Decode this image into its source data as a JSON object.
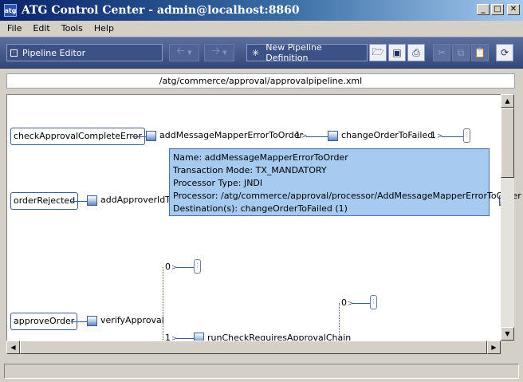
{
  "window": {
    "icon_label": "atg",
    "title": "ATG Control Center - admin@localhost:8860",
    "minimize": "_",
    "maximize": "□",
    "close": "✕"
  },
  "menu": [
    "File",
    "Edit",
    "Tools",
    "Help"
  ],
  "toolbar": {
    "editor_select": "Pipeline Editor",
    "new_definition": "New Pipeline Definition",
    "icons": [
      "back-icon",
      "forward-icon",
      "open-folder-icon",
      "save-icon",
      "print-icon",
      "cut-icon",
      "copy-icon",
      "paste-icon",
      "refresh-icon"
    ]
  },
  "path": "/atg/commerce/approval/approvalpipeline.xml",
  "diagram": {
    "chains": {
      "check_approval_complete_error": "checkApprovalCompleteError",
      "order_rejected": "orderRejected",
      "approve_order": "approveOrder"
    },
    "processors": {
      "add_message_mapper_error": "addMessageMapperErrorToOrder",
      "change_order_to_failed": "changeOrderToFailed",
      "add_approver_id": "addApproverIdTo",
      "verify_approval": "verifyApproval",
      "run_check_requires_approval": "runCheckRequiresApprovalChain"
    },
    "transitions": {
      "one_a": "1",
      "one_b": "1",
      "zero_a": "0",
      "zero_b": "0",
      "one_c": "1"
    }
  },
  "tooltip": {
    "name": "Name: addMessageMapperErrorToOrder",
    "transaction": "Transaction Mode: TX_MANDATORY",
    "type": "Processor Type: JNDI",
    "processor": "Processor: /atg/commerce/approval/processor/AddMessageMapperErrorToOrder",
    "destinations": "Destination(s): changeOrderToFailed (1)"
  },
  "status_text": ""
}
